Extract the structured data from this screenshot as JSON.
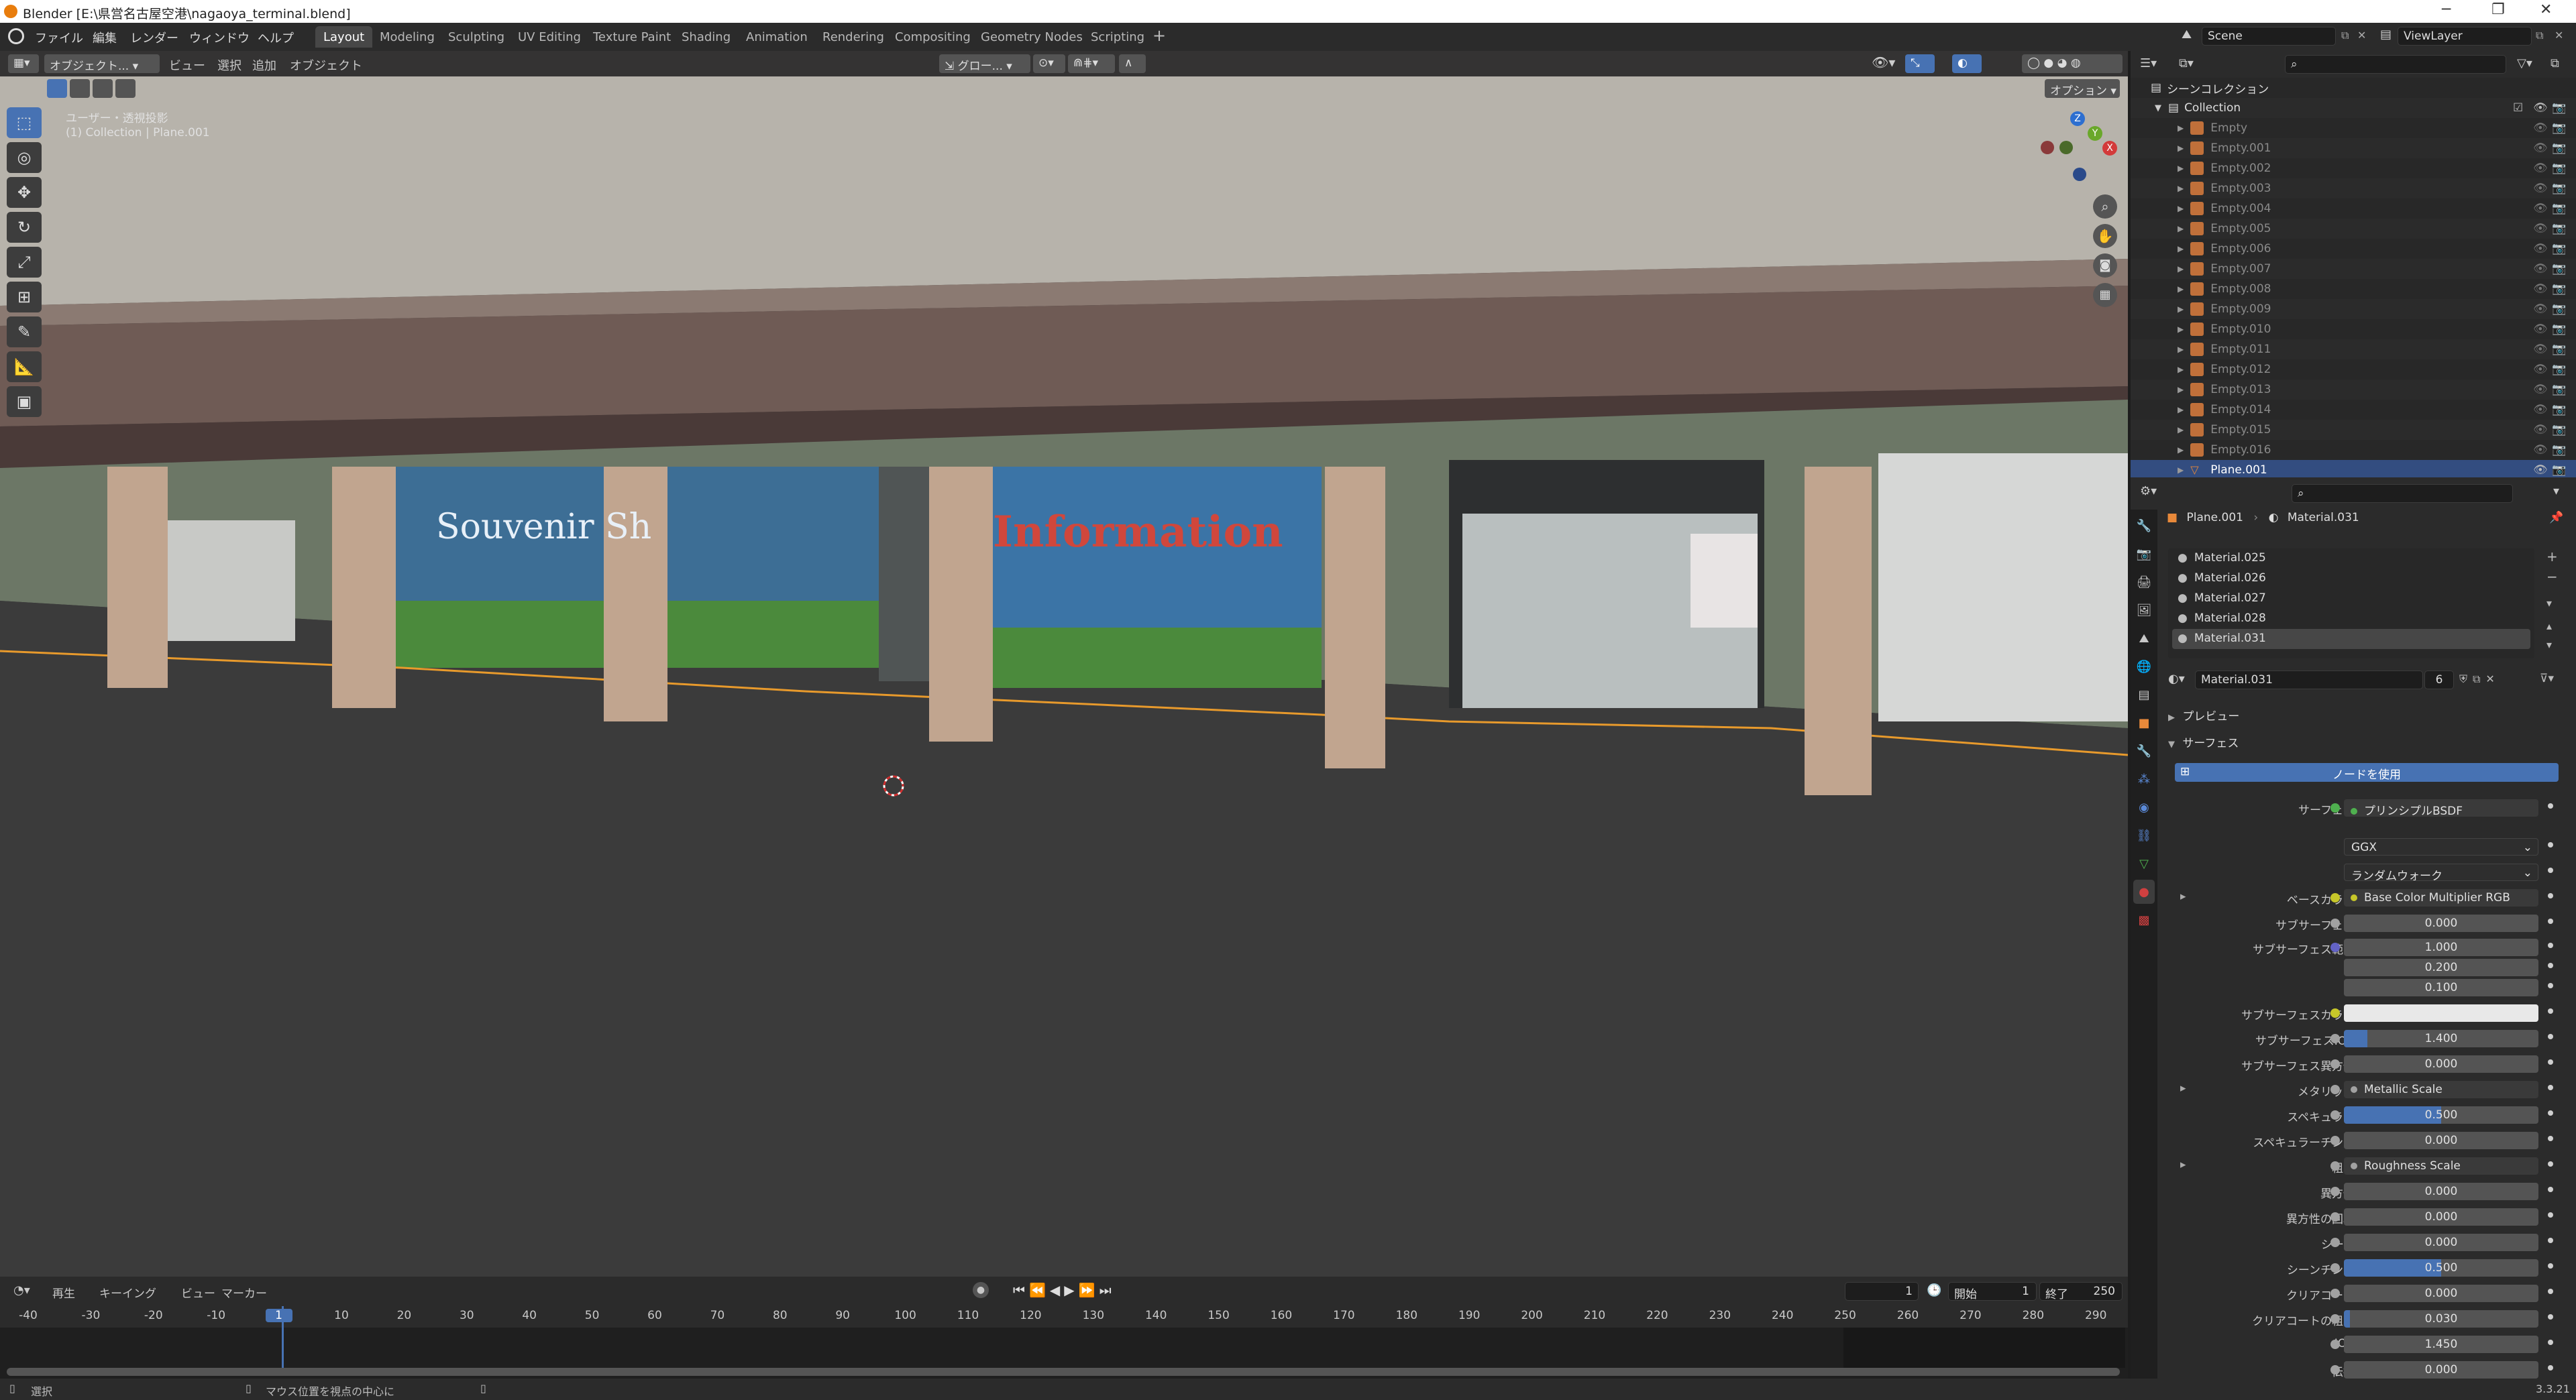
{
  "window": {
    "title": "Blender [E:\\県営名古屋空港\\nagaoya_terminal.blend]"
  },
  "menu": [
    "ファイル",
    "編集",
    "レンダー",
    "ウィンドウ",
    "ヘルプ"
  ],
  "workspaces": [
    "Layout",
    "Modeling",
    "Sculpting",
    "UV Editing",
    "Texture Paint",
    "Shading",
    "Animation",
    "Rendering",
    "Compositing",
    "Geometry Nodes",
    "Scripting"
  ],
  "active_workspace": "Layout",
  "scene": {
    "name": "Scene",
    "viewlayer": "ViewLayer"
  },
  "viewport": {
    "mode": "オブジェクト...",
    "menus": [
      "ビュー",
      "選択",
      "追加",
      "オブジェクト"
    ],
    "transform": "グロー...",
    "options": "オプション",
    "overlay_line1": "ユーザー・透視投影",
    "overlay_line2": "(1) Collection | Plane.001",
    "gizmo_axes": [
      "Z",
      "Y",
      "X"
    ],
    "scene_signs": [
      "Souvenir Sh",
      "Information"
    ]
  },
  "timeline": {
    "menus": [
      "再生",
      "キーイング",
      "ビュー",
      "マーカー"
    ],
    "current_frame": "1",
    "start_label": "開始",
    "start": "1",
    "end_label": "終了",
    "end": "250",
    "ticks": [
      "-40",
      "-30",
      "-20",
      "-10",
      "1",
      "10",
      "20",
      "30",
      "40",
      "50",
      "60",
      "70",
      "80",
      "90",
      "100",
      "110",
      "120",
      "130",
      "140",
      "150",
      "160",
      "170",
      "180",
      "190",
      "200",
      "210",
      "220",
      "230",
      "240",
      "250",
      "260",
      "270",
      "280",
      "290"
    ]
  },
  "statusbar": {
    "left": "選択",
    "middle": "マウス位置を視点の中心に",
    "version": "3.3.21"
  },
  "outliner": {
    "root": "シーンコレクション",
    "collection": "Collection",
    "items": [
      "Empty",
      "Empty.001",
      "Empty.002",
      "Empty.003",
      "Empty.004",
      "Empty.005",
      "Empty.006",
      "Empty.007",
      "Empty.008",
      "Empty.009",
      "Empty.010",
      "Empty.011",
      "Empty.012",
      "Empty.013",
      "Empty.014",
      "Empty.015",
      "Empty.016",
      "Plane.001"
    ],
    "selected": "Plane.001"
  },
  "properties": {
    "breadcrumb_object": "Plane.001",
    "breadcrumb_material": "Material.031",
    "slots": [
      "Material.025",
      "Material.026",
      "Material.027",
      "Material.028",
      "Material.031"
    ],
    "material_name": "Material.031",
    "users": "6",
    "panel_preview": "プレビュー",
    "panel_surface": "サーフェス",
    "use_nodes": "ノードを使用",
    "rows": [
      {
        "label": "サーフェス",
        "value": "プリンシプルBSDF",
        "type": "link",
        "dot": "#4fb04f"
      },
      {
        "label": "",
        "value": "GGX",
        "type": "dropdown"
      },
      {
        "label": "",
        "value": "ランダムウォーク",
        "type": "dropdown"
      },
      {
        "label": "ベースカラー",
        "value": "Base Color Multiplier RGB",
        "type": "link",
        "dot": "#c7c729",
        "expand": true
      },
      {
        "label": "サブサーフェス",
        "value": "0.000",
        "type": "num",
        "dot": "#a1a1a1",
        "fill": 0
      },
      {
        "label": "サブサーフェス範囲",
        "value": "1.000",
        "type": "num",
        "dot": "#6363c7",
        "fill": 0
      },
      {
        "label": "",
        "value": "0.200",
        "type": "num",
        "fill": 0
      },
      {
        "label": "",
        "value": "0.100",
        "type": "num",
        "fill": 0
      },
      {
        "label": "サブサーフェスカラー",
        "value": "",
        "type": "color",
        "dot": "#c7c729",
        "color": "#e8e8e8"
      },
      {
        "label": "サブサーフェスIOR",
        "value": "1.400",
        "type": "num",
        "dot": "#a1a1a1",
        "fill": 0.12
      },
      {
        "label": "サブサーフェス異方性",
        "value": "0.000",
        "type": "num",
        "dot": "#a1a1a1",
        "fill": 0
      },
      {
        "label": "メタリック",
        "value": "Metallic Scale",
        "type": "link",
        "dot": "#a1a1a1",
        "expand": true
      },
      {
        "label": "スペキュラー",
        "value": "0.500",
        "type": "num",
        "dot": "#a1a1a1",
        "fill": 0.5
      },
      {
        "label": "スペキュラーチント",
        "value": "0.000",
        "type": "num",
        "dot": "#a1a1a1",
        "fill": 0
      },
      {
        "label": "粗さ",
        "value": "Roughness Scale",
        "type": "link",
        "dot": "#a1a1a1",
        "expand": true
      },
      {
        "label": "異方性",
        "value": "0.000",
        "type": "num",
        "dot": "#a1a1a1",
        "fill": 0
      },
      {
        "label": "異方性の回転",
        "value": "0.000",
        "type": "num",
        "dot": "#a1a1a1",
        "fill": 0
      },
      {
        "label": "シーン",
        "value": "0.000",
        "type": "num",
        "dot": "#a1a1a1",
        "fill": 0
      },
      {
        "label": "シーンチント",
        "value": "0.500",
        "type": "num",
        "dot": "#a1a1a1",
        "fill": 0.5
      },
      {
        "label": "クリアコート",
        "value": "0.000",
        "type": "num",
        "dot": "#a1a1a1",
        "fill": 0
      },
      {
        "label": "クリアコートの粗さ",
        "value": "0.030",
        "type": "num",
        "dot": "#a1a1a1",
        "fill": 0.03
      },
      {
        "label": "IOR",
        "value": "1.450",
        "type": "num",
        "dot": "#a1a1a1",
        "fill": 0
      },
      {
        "label": "伝播",
        "value": "0.000",
        "type": "num",
        "dot": "#a1a1a1",
        "fill": 0
      }
    ]
  },
  "colors": {
    "accent": "#4772b3",
    "selection": "#334d80",
    "header": "#2b2b2b",
    "panel": "#282828"
  }
}
